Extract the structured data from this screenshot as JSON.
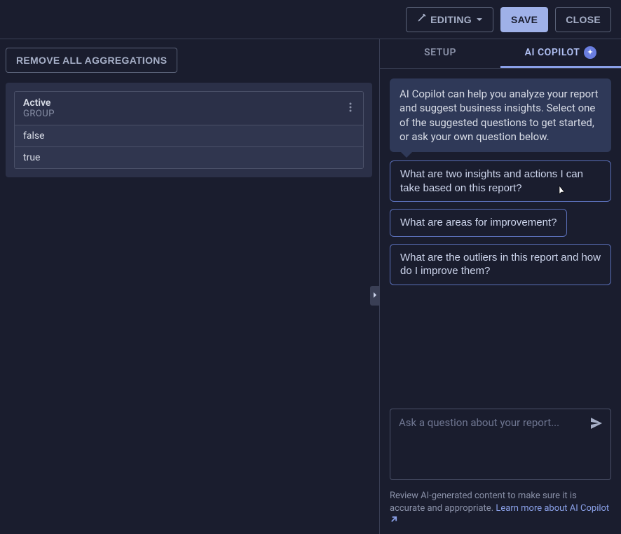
{
  "toolbar": {
    "editing_label": "EDITING",
    "save_label": "SAVE",
    "close_label": "CLOSE"
  },
  "left_panel": {
    "remove_all_label": "REMOVE ALL AGGREGATIONS",
    "aggregation": {
      "title": "Active",
      "subtitle": "GROUP",
      "rows": [
        "false",
        "true"
      ]
    }
  },
  "tabs": {
    "setup_label": "SETUP",
    "copilot_label": "AI COPILOT"
  },
  "copilot": {
    "intro": "AI Copilot can help you analyze your report and suggest business insights. Select one of the suggested questions to get started, or ask your own question below.",
    "suggestions": [
      "What are two insights and actions I can take based on this report?",
      "What are areas for improvement?",
      "What are the outliers in this report and how do I improve them?"
    ],
    "input_placeholder": "Ask a question about your report...",
    "disclaimer_text": "Review AI-generated content to make sure it is accurate and appropriate. ",
    "learn_more_label": "Learn more about AI Copilot"
  }
}
